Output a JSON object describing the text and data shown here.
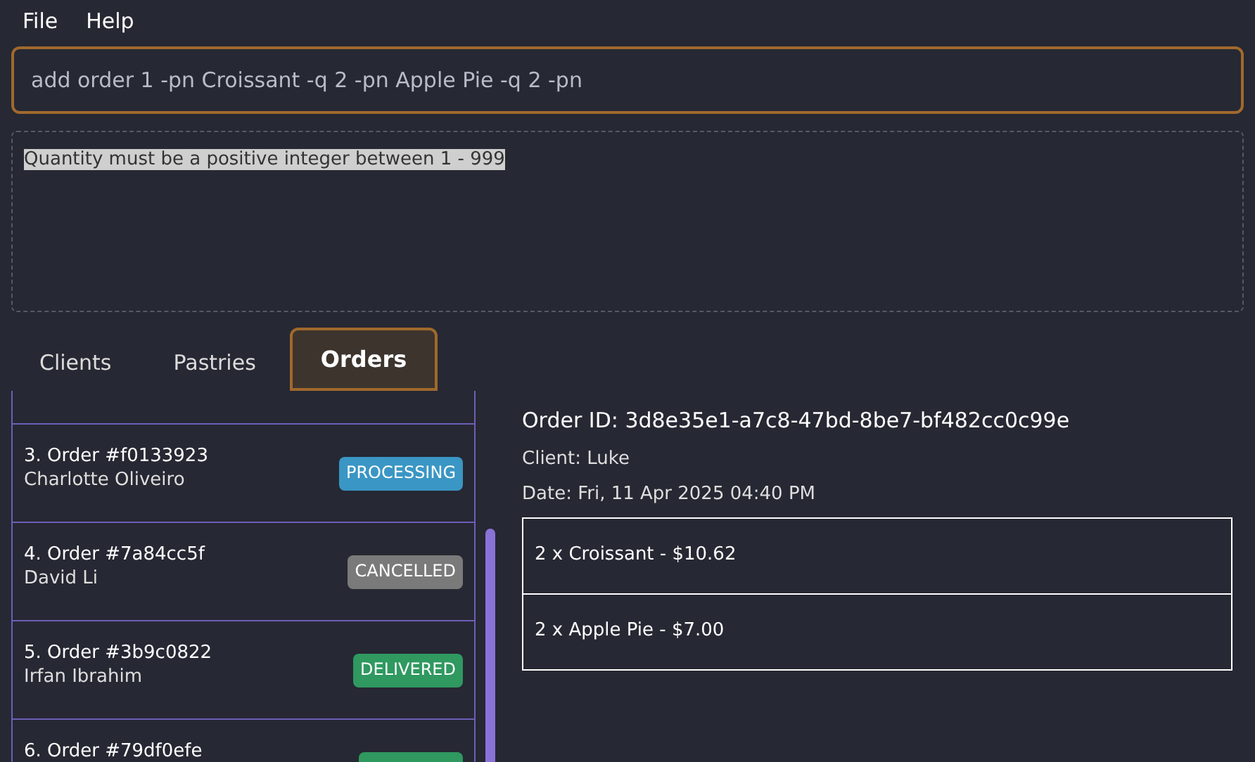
{
  "menu": [
    "File",
    "Help"
  ],
  "command": {
    "value": "add order 1 -pn Croissant -q 2 -pn Apple Pie -q 2 -pn"
  },
  "result": {
    "text": "Quantity must be a positive integer between 1 - 999"
  },
  "tabs": [
    {
      "label": "Clients",
      "selected": false
    },
    {
      "label": "Pastries",
      "selected": false
    },
    {
      "label": "Orders",
      "selected": true
    }
  ],
  "orders": [
    {
      "title": "3. Order #f0133923",
      "client": "Charlotte Oliveiro",
      "status": "PROCESSING",
      "color": "#3a96c4"
    },
    {
      "title": "4. Order #7a84cc5f",
      "client": "David Li",
      "status": "CANCELLED",
      "color": "#7a7a7a"
    },
    {
      "title": "5. Order #3b9c0822",
      "client": "Irfan Ibrahim",
      "status": "DELIVERED",
      "color": "#2f9960"
    },
    {
      "title": "6. Order #79df0efe",
      "color": "#2f9960"
    }
  ],
  "detail": {
    "order_id": "Order ID: 3d8e35e1-a7c8-47bd-8be7-bf482cc0c99e",
    "client": "Client: Luke",
    "date": "Date: Fri, 11 Apr 2025 04:40 PM",
    "items": [
      "2 x Croissant - $10.62",
      "2 x Apple Pie - $7.00"
    ]
  }
}
